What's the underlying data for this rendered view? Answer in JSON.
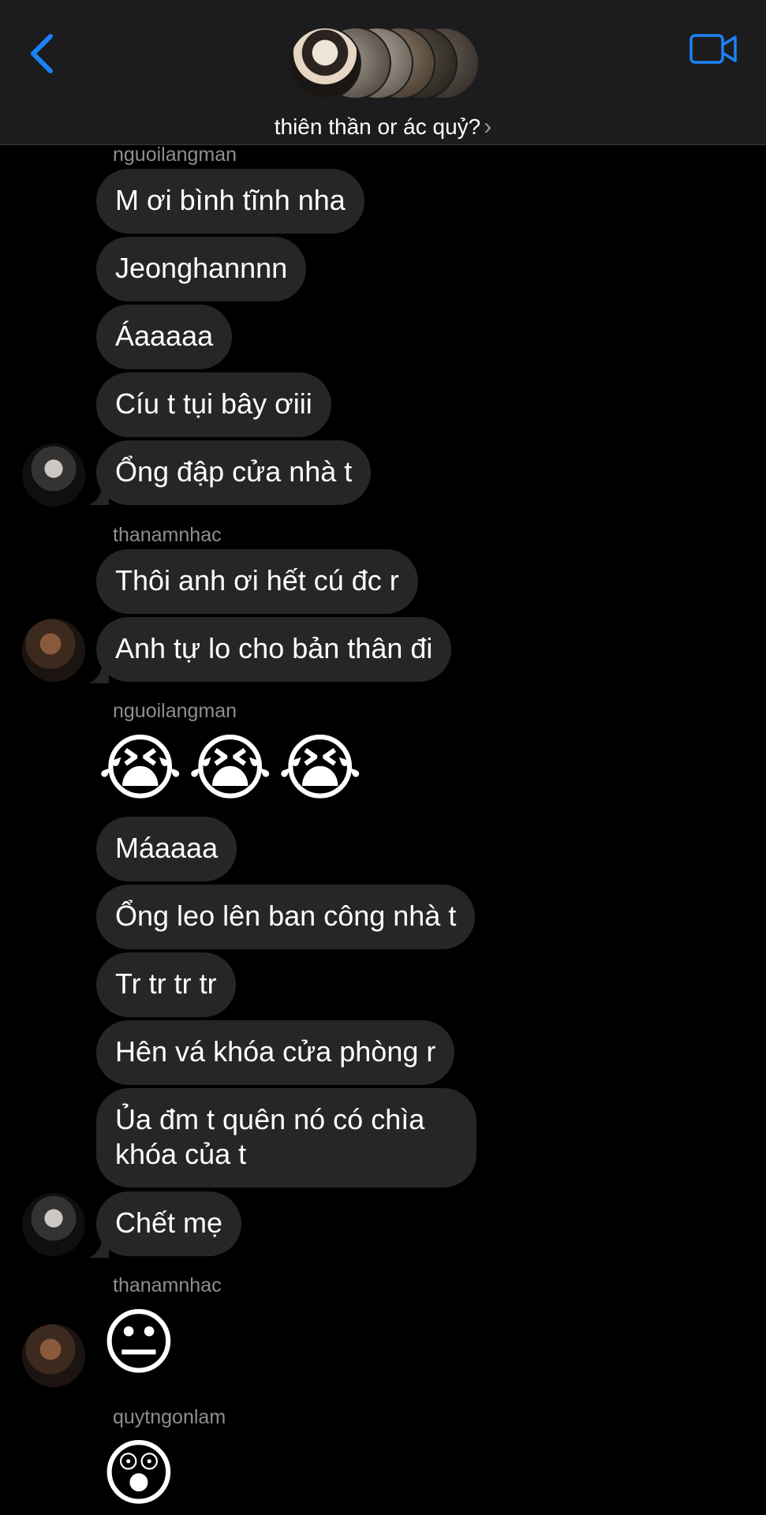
{
  "header": {
    "title": "thiên thần or ác quỷ?",
    "chevron": "›",
    "back_icon": "chevron-left-icon",
    "video_icon": "video-camera-icon",
    "accent": "#1a82f7"
  },
  "messages": [
    {
      "type": "sender",
      "text": "nguoilangman"
    },
    {
      "type": "bubble",
      "text": "M ơi bình tĩnh nha"
    },
    {
      "type": "bubble",
      "text": "Jeonghannnn"
    },
    {
      "type": "bubble",
      "text": "Áaaaaa"
    },
    {
      "type": "bubble",
      "text": "Cíu t tụi bây ơiii"
    },
    {
      "type": "bubble",
      "text": "Ổng đập cửa nhà t"
    },
    {
      "type": "sender",
      "text": "thanamnhac"
    },
    {
      "type": "bubble",
      "text": "Thôi anh ơi hết cú đc r"
    },
    {
      "type": "bubble",
      "text": "Anh tự lo cho bản thân đi"
    },
    {
      "type": "sender",
      "text": "nguoilangman"
    },
    {
      "type": "emoji",
      "text": "😭"
    },
    {
      "type": "bubble",
      "text": "Máaaaa"
    },
    {
      "type": "bubble",
      "text": "Ổng leo lên ban công nhà t"
    },
    {
      "type": "bubble",
      "text": "Tr tr tr tr"
    },
    {
      "type": "bubble",
      "text": "Hên vá khóa cửa phòng r"
    },
    {
      "type": "bubble",
      "line1": "Ủa đm t quên nó có chìa",
      "line2": "khóa của t"
    },
    {
      "type": "bubble",
      "text": "Chết mẹ"
    },
    {
      "type": "sender",
      "text": "thanamnhac"
    },
    {
      "type": "emoji",
      "text": "😐"
    },
    {
      "type": "sender",
      "text": "quytngonlam"
    },
    {
      "type": "emoji",
      "text": "😲"
    }
  ],
  "colors": {
    "background": "#000000",
    "header_bg": "#1c1c1e",
    "bubble_bg": "#262628",
    "sender_text": "#8e8e93"
  }
}
